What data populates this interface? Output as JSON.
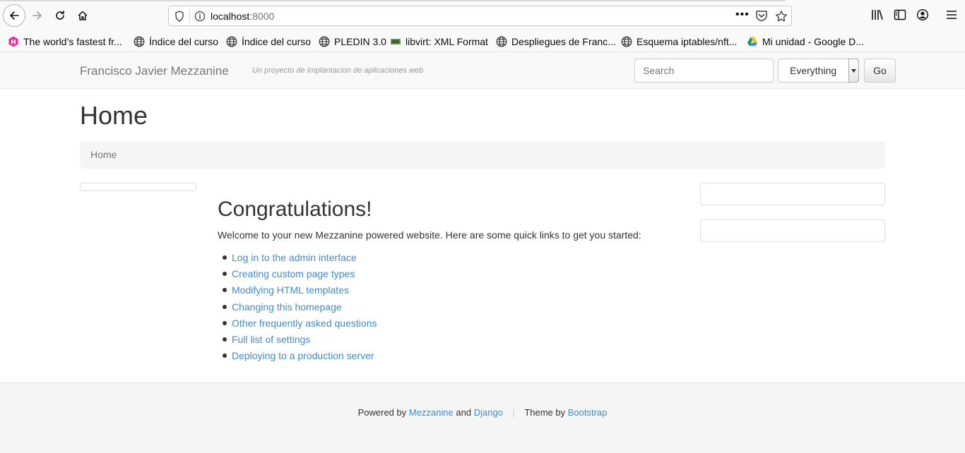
{
  "browser": {
    "url_host": "localhost",
    "url_port": ":8000",
    "bookmarks": [
      {
        "label": "The world’s fastest fr...",
        "icon": "hasura-icon"
      },
      {
        "label": "Índice del curso",
        "icon": "globe-icon"
      },
      {
        "label": "Índice del curso",
        "icon": "globe-icon"
      },
      {
        "label": "PLEDIN 3.0",
        "icon": "globe-icon"
      },
      {
        "label": "libvirt: XML Format",
        "icon": "libvirt-icon"
      },
      {
        "label": "Despliegues de Franc...",
        "icon": "globe-icon"
      },
      {
        "label": "Esquema iptables/nft...",
        "icon": "globe-icon"
      },
      {
        "label": "Mi unidad - Google D...",
        "icon": "google-drive-icon"
      }
    ]
  },
  "site": {
    "brand": "Francisco Javier Mezzanine",
    "tagline": "Un proyecto de Implantacion de aplicaciones web",
    "search": {
      "placeholder": "Search",
      "scope": "Everything",
      "go_label": "Go"
    }
  },
  "page": {
    "title": "Home",
    "breadcrumb": "Home",
    "heading": "Congratulations!",
    "intro": "Welcome to your new Mezzanine powered website. Here are some quick links to get you started:",
    "links": [
      "Log in to the admin interface",
      "Creating custom page types",
      "Modifying HTML templates",
      "Changing this homepage",
      "Other frequently asked questions",
      "Full list of settings",
      "Deploying to a production server"
    ]
  },
  "footer": {
    "powered_by": "Powered by",
    "mezzanine": "Mezzanine",
    "and": "and",
    "django": "Django",
    "theme_by": "Theme by",
    "bootstrap": "Bootstrap"
  },
  "colors": {
    "link": "#428bca",
    "navbar_bg": "#f8f8f8",
    "footer_bg": "#f5f5f5"
  }
}
